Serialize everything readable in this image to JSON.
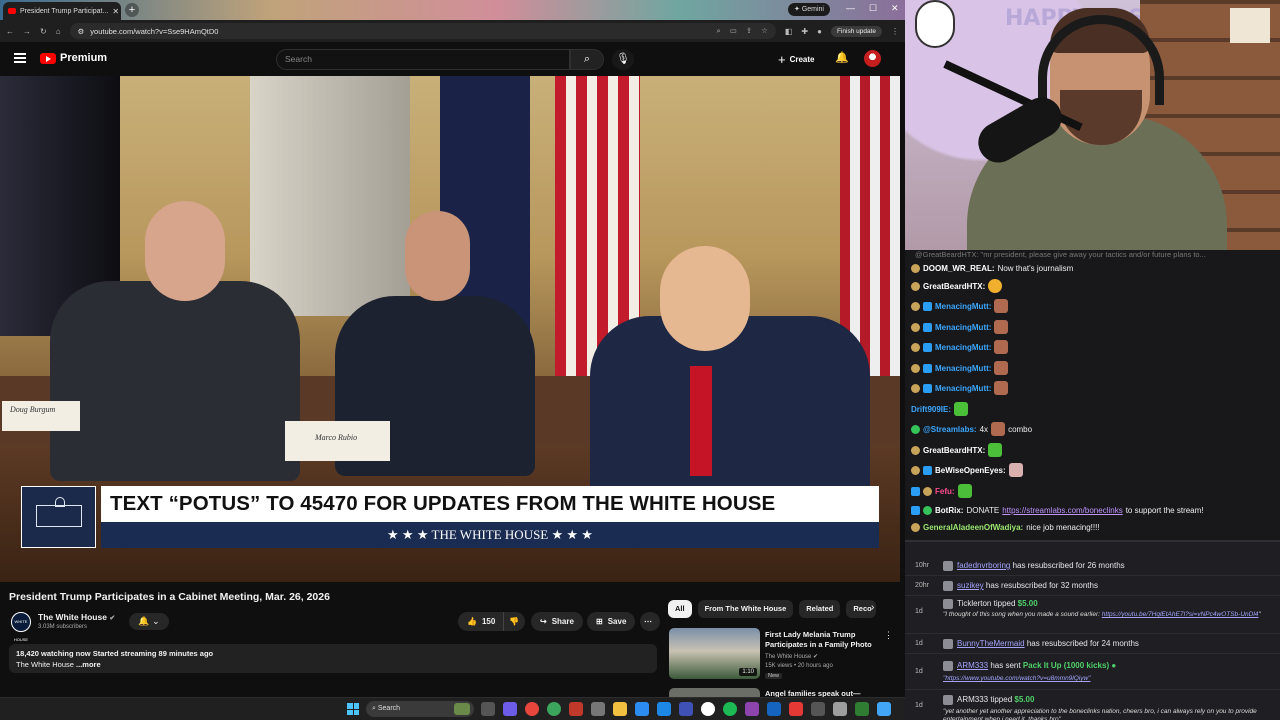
{
  "browser": {
    "tab_title": "President Trump Participat...",
    "url": "youtube.com/watch?v=Sse9HAmQtD0",
    "gemini_label": "Gemini",
    "finish_update": "Finish update"
  },
  "youtube": {
    "logo_text": "Premium",
    "search_placeholder": "Search",
    "create_label": "Create",
    "video": {
      "lower_third_headline": "TEXT “POTUS” TO 45470 FOR UPDATES FROM THE WHITE HOUSE",
      "lower_third_sub": "★ ★ ★   THE WHITE HOUSE   ★ ★ ★",
      "placard_1": "Doug Burgum",
      "placard_2": "Marco Rubio"
    },
    "title": "President Trump Participates in a Cabinet Meeting, Mar. 26, 2026",
    "channel": {
      "name": "The White House",
      "subscribers": "3.03M subscribers",
      "avatar_text": "WHITE HOUSE"
    },
    "actions": {
      "likes": "150",
      "share": "Share",
      "save": "Save"
    },
    "description": {
      "line1": "18,420 watching now  Started streaming 89 minutes ago",
      "line2": "The White House",
      "more": "...more"
    },
    "chips": [
      "All",
      "From The White House",
      "Related",
      "Reco"
    ],
    "recommendations": [
      {
        "title": "First Lady Melania Trump Participates in a Family Photo",
        "channel": "The White House",
        "meta": "15K views • 20 hours ago",
        "badge": "New",
        "duration": "1:10"
      },
      {
        "title": "Angel families speak out—"
      }
    ]
  },
  "taskbar": {
    "search_label": "Search"
  },
  "cam": {
    "wall_text": "HAPPY EAST"
  },
  "chat": {
    "header": "@GreatBeardHTX: \"mr president, please give away your tactics and/or future plans to...",
    "messages": [
      {
        "user": "DOOM_WR_REAL:",
        "text": "Now that's journalism",
        "color": "#ffffff"
      },
      {
        "user": "GreatBeardHTX:",
        "text": "",
        "color": "#ffffff"
      },
      {
        "user": "MenacingMutt:",
        "text": "",
        "color": "#3ba7ff"
      },
      {
        "user": "MenacingMutt:",
        "text": "",
        "color": "#3ba7ff"
      },
      {
        "user": "MenacingMutt:",
        "text": "",
        "color": "#3ba7ff"
      },
      {
        "user": "MenacingMutt:",
        "text": "",
        "color": "#3ba7ff"
      },
      {
        "user": "MenacingMutt:",
        "text": "",
        "color": "#3ba7ff"
      },
      {
        "user": "Drift909IE:",
        "text": "",
        "color": "#3ba7ff"
      },
      {
        "user": "@Streamlabs:",
        "text": "4x",
        "text2": "combo",
        "color": "#3ba7ff"
      },
      {
        "user": "GreatBeardHTX:",
        "text": "",
        "color": "#ffffff"
      },
      {
        "user": "BeWiseOpenEyes:",
        "text": "",
        "color": "#ffffff"
      },
      {
        "user": "Fefu:",
        "text": "",
        "color": "#ff4d8d"
      },
      {
        "user": "BotRix:",
        "text": "DONATE",
        "link": "https://streamlabs.com/boneclinks",
        "text2": "to support the stream!",
        "color": "#ffffff"
      },
      {
        "user": "GeneralAladeenOfWadiya:",
        "text": "nice job menacing!!!!",
        "color": "#9ae66e"
      }
    ]
  },
  "alerts": [
    {
      "time": "10hr",
      "user": "fadednvrboring",
      "text": "has resubscribed for 26 months"
    },
    {
      "time": "20hr",
      "user": "suzikey",
      "text": "has resubscribed for 32 months"
    },
    {
      "time": "1d",
      "user": "Ticklerton",
      "text": "tipped",
      "amount": "$5.00",
      "quote": "\"I thought of this song when you made a sound earlier:",
      "quote_link": "https://youtu.be/7HqlEtAhE7I?si=vNPc4wOTSb-UnDl4",
      "quote_end": "\""
    },
    {
      "time": "1d",
      "user": "BunnyTheMermaid",
      "text": "has resubscribed for 24 months"
    },
    {
      "time": "1d",
      "user": "ARM333",
      "text": "has sent",
      "amount": "Pack It Up (1000 kicks)",
      "quote_link": "\"https://www.youtube.com/watch?v=u8mmn9lQiyw\""
    },
    {
      "time": "1d",
      "user": "ARM333",
      "text": "tipped",
      "amount": "$5.00",
      "quote": "\"yet another yet another appreciation to the boneclinks nation, cheers bro, i can always rely on you to provide entertainment when i need it, thanks bro\""
    }
  ]
}
